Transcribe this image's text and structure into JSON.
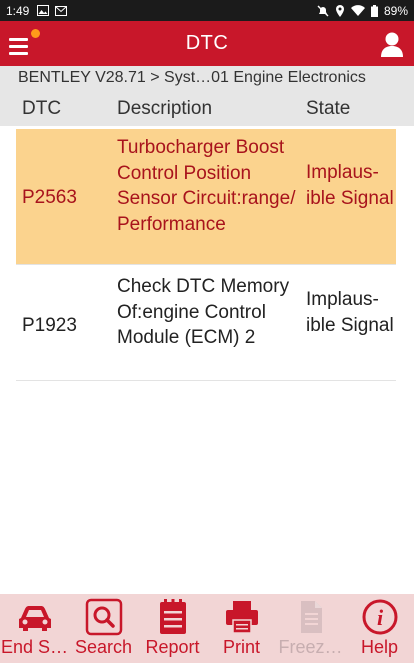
{
  "status_bar": {
    "time": "1:49",
    "battery": "89%",
    "left_icons": [
      "image-icon",
      "email-icon"
    ],
    "right_icons": [
      "mute-icon",
      "location-icon",
      "wifi-icon",
      "battery-icon"
    ]
  },
  "app_bar": {
    "title": "DTC",
    "menu_icon": "menu-icon",
    "notification_dot_color": "#ff9a1a",
    "user_icon": "user-icon"
  },
  "breadcrumb": "BENTLEY V28.71 > Syst…01 Engine Electronics",
  "table": {
    "headers": {
      "code": "DTC",
      "description": "Description",
      "state": "State"
    },
    "rows": [
      {
        "code": "P2563",
        "description": "Turbocharger Boost Control Position Sensor Circuit:range/ Performance",
        "state": "Implaus-ible Signal",
        "highlighted": true
      },
      {
        "code": "P1923",
        "description": "Check DTC Memory Of:engine Control Module (ECM) 2",
        "state": "Implaus-ible Signal",
        "highlighted": false
      }
    ]
  },
  "toolbar": {
    "items": [
      {
        "label": "End S…",
        "icon": "car-icon",
        "enabled": true
      },
      {
        "label": "Search",
        "icon": "search-icon",
        "enabled": true
      },
      {
        "label": "Report",
        "icon": "report-icon",
        "enabled": true
      },
      {
        "label": "Print",
        "icon": "printer-icon",
        "enabled": true
      },
      {
        "label": "Freez…",
        "icon": "freeze-frame-icon",
        "enabled": false
      },
      {
        "label": "Help",
        "icon": "help-icon",
        "enabled": true
      }
    ]
  },
  "colors": {
    "accent": "#c8172a",
    "highlight_row": "#fbd38e",
    "highlight_text": "#a8131c",
    "toolbar_bg": "#f2d5d5"
  }
}
